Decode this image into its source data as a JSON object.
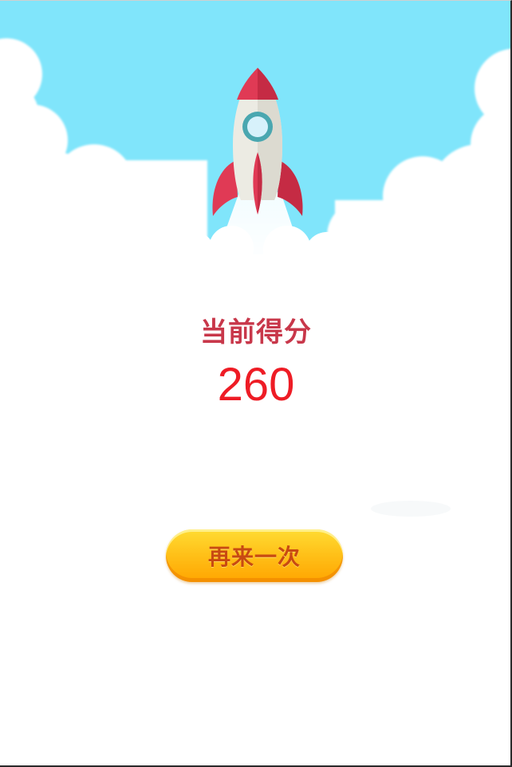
{
  "score": {
    "label": "当前得分",
    "value": "260"
  },
  "actions": {
    "replay_label": "再来一次"
  },
  "colors": {
    "sky": "#80e5fb",
    "rocket_red": "#e03a55",
    "score_label": "#c8374a",
    "score_value": "#ee1c25",
    "button_yellow": "#ffc21a",
    "button_text": "#c84a12"
  },
  "icons": {
    "rocket": "rocket-icon",
    "clouds": "cloud-icon"
  }
}
